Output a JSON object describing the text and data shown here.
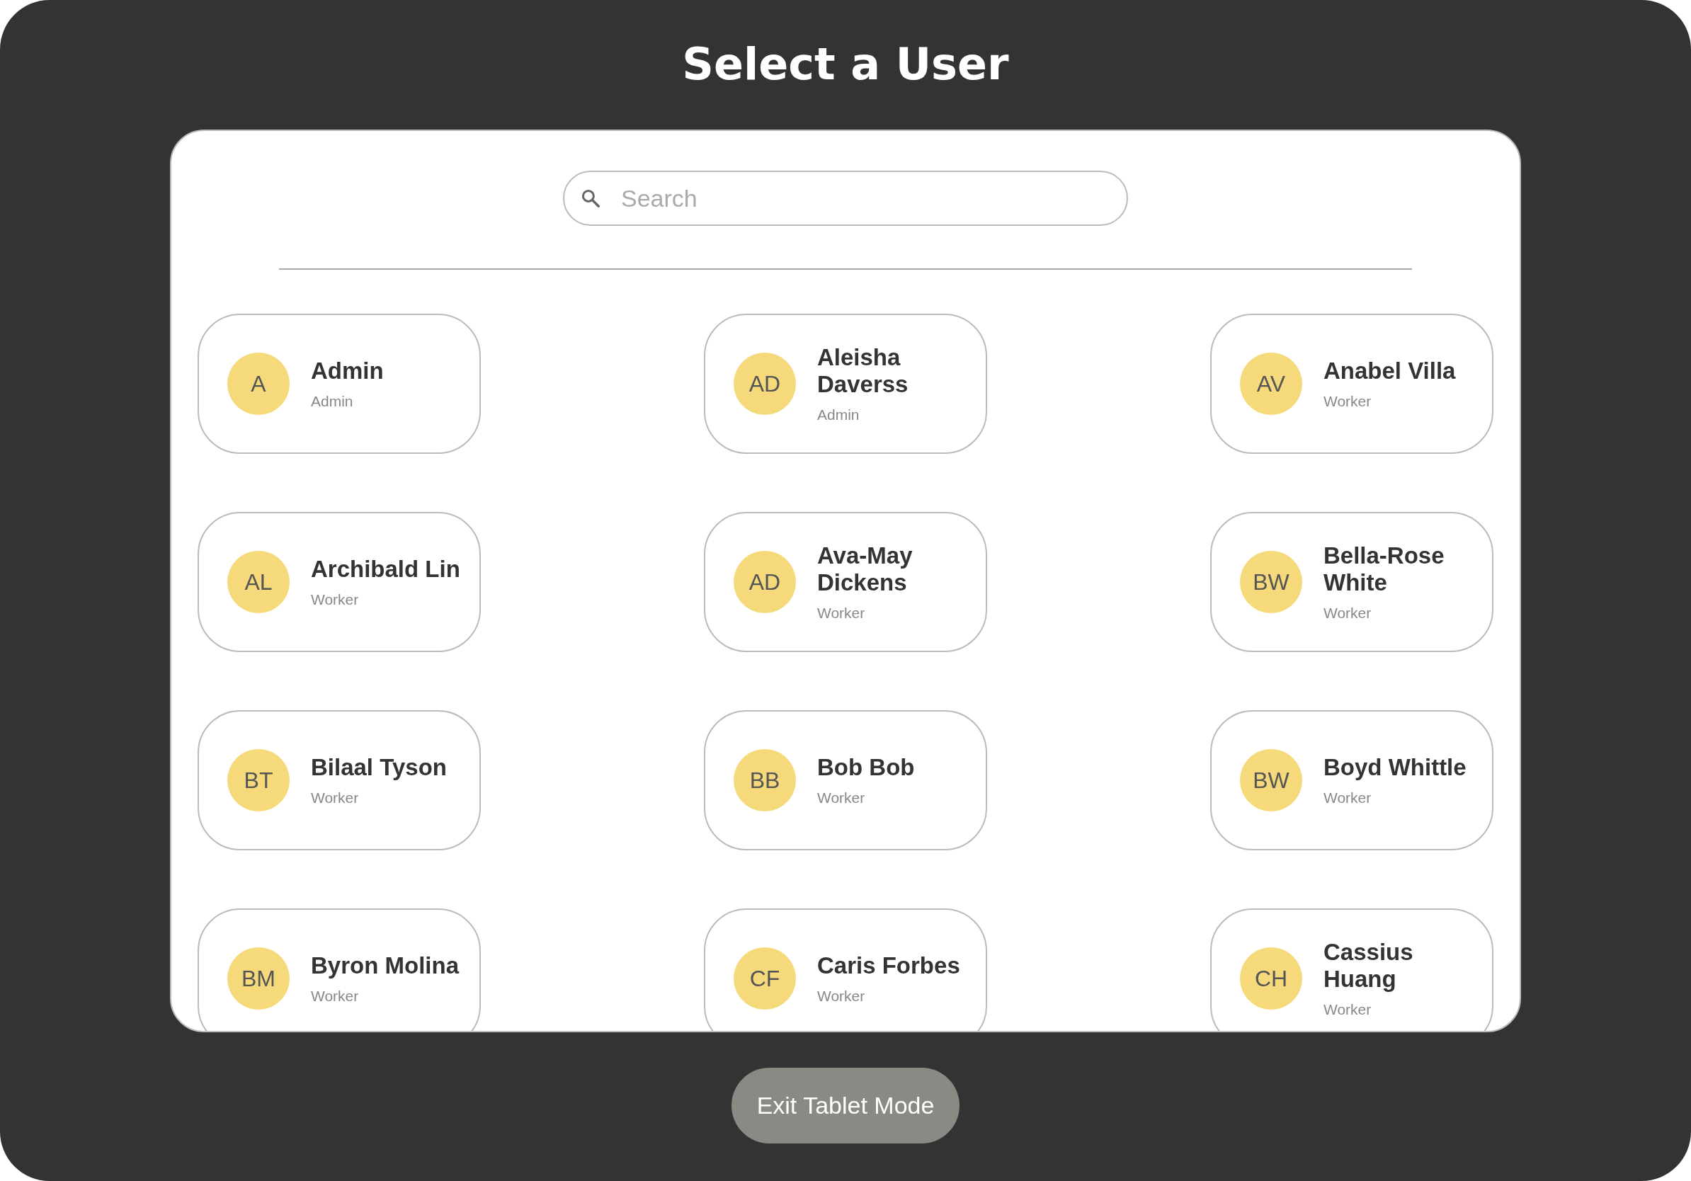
{
  "title": "Select a User",
  "search": {
    "placeholder": "Search"
  },
  "users": [
    {
      "initials": "A",
      "name": "Admin",
      "role": "Admin"
    },
    {
      "initials": "AD",
      "name": "Aleisha Daverss",
      "role": "Admin"
    },
    {
      "initials": "AV",
      "name": "Anabel Villa",
      "role": "Worker"
    },
    {
      "initials": "AL",
      "name": "Archibald Lin",
      "role": "Worker"
    },
    {
      "initials": "AD",
      "name": "Ava-May Dickens",
      "role": "Worker"
    },
    {
      "initials": "BW",
      "name": "Bella-Rose White",
      "role": "Worker"
    },
    {
      "initials": "BT",
      "name": "Bilaal Tyson",
      "role": "Worker"
    },
    {
      "initials": "BB",
      "name": "Bob Bob",
      "role": "Worker"
    },
    {
      "initials": "BW",
      "name": "Boyd Whittle",
      "role": "Worker"
    },
    {
      "initials": "BM",
      "name": "Byron Molina",
      "role": "Worker"
    },
    {
      "initials": "CF",
      "name": "Caris Forbes",
      "role": "Worker"
    },
    {
      "initials": "CH",
      "name": "Cassius Huang",
      "role": "Worker"
    }
  ],
  "exit_button": "Exit Tablet Mode"
}
